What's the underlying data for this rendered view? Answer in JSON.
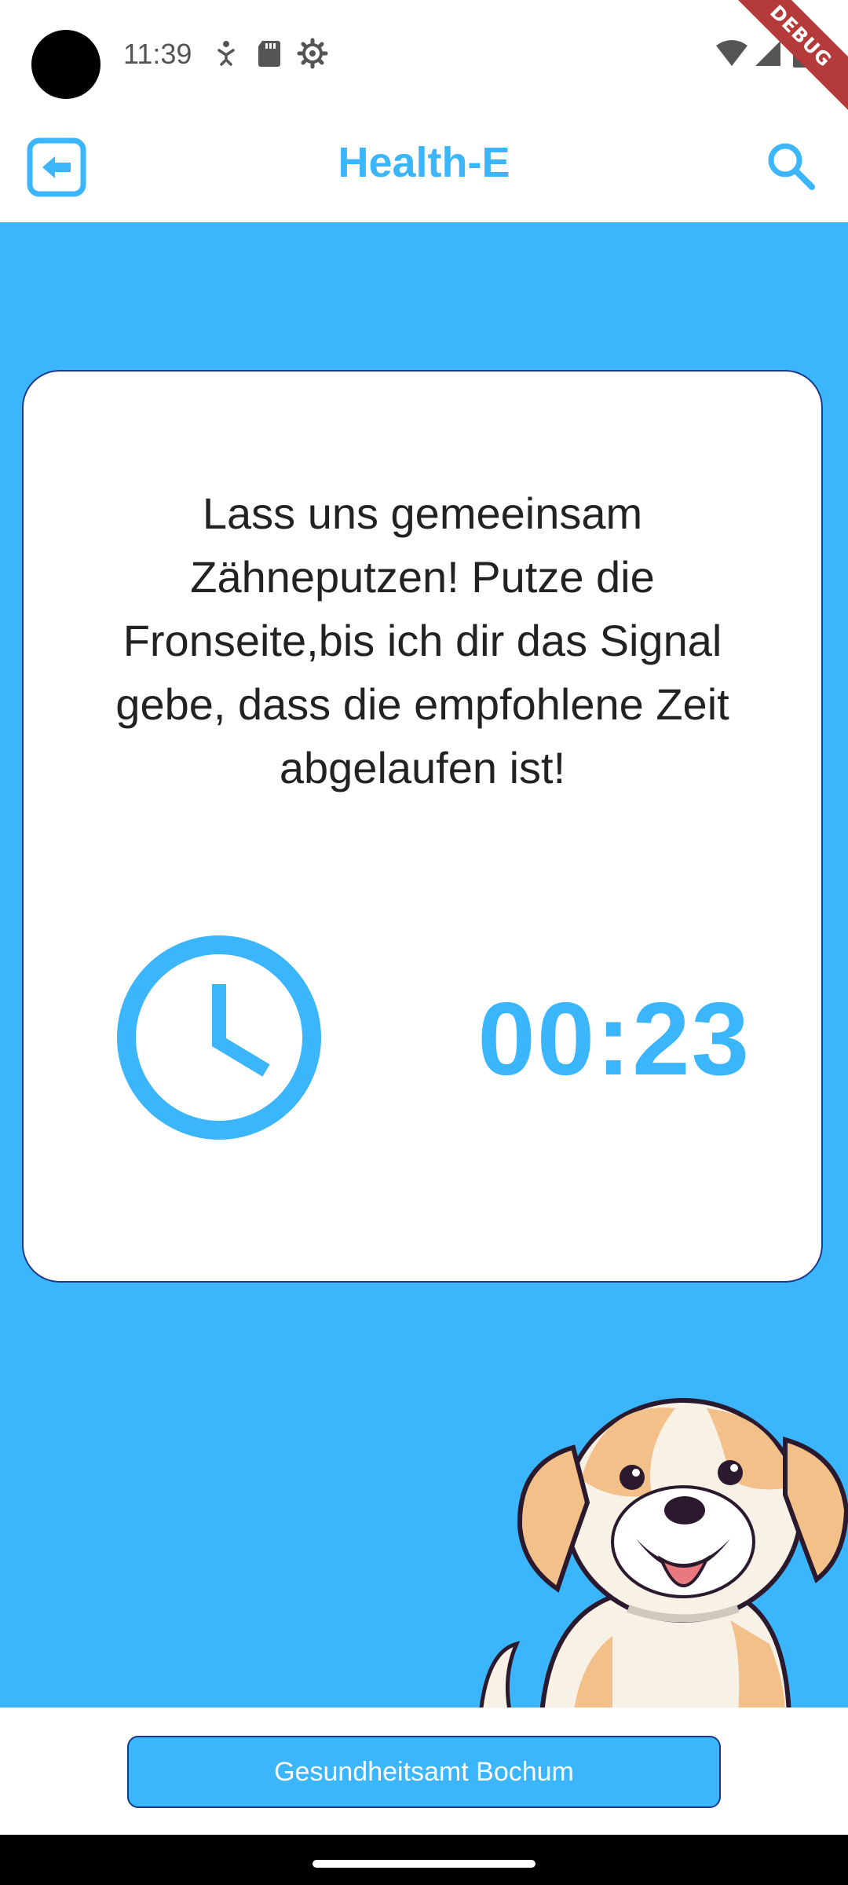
{
  "status_bar": {
    "time": "11:39",
    "debug_label": "DEBUG",
    "icons": [
      "accessibility-icon",
      "sd-card-icon",
      "settings-gear-icon",
      "wifi-icon",
      "cell-signal-icon",
      "battery-icon"
    ]
  },
  "app_bar": {
    "title": "Health-E",
    "back_icon": "back-arrow-icon",
    "search_icon": "search-icon"
  },
  "card": {
    "message": "Lass uns gemeeinsam Zähneputzen! Putze die Fronseite,bis ich dir das Signal gebe, dass die empfohlene Zeit abgelaufen ist!",
    "clock_icon": "clock-icon",
    "timer": "00:23"
  },
  "mascot": {
    "icon": "dog-mascot"
  },
  "footer": {
    "button_label": "Gesundheitsamt Bochum"
  },
  "colors": {
    "accent": "#3bb6fd",
    "border": "#1d3a8a",
    "text": "#222222",
    "debug": "#b53a3a"
  }
}
